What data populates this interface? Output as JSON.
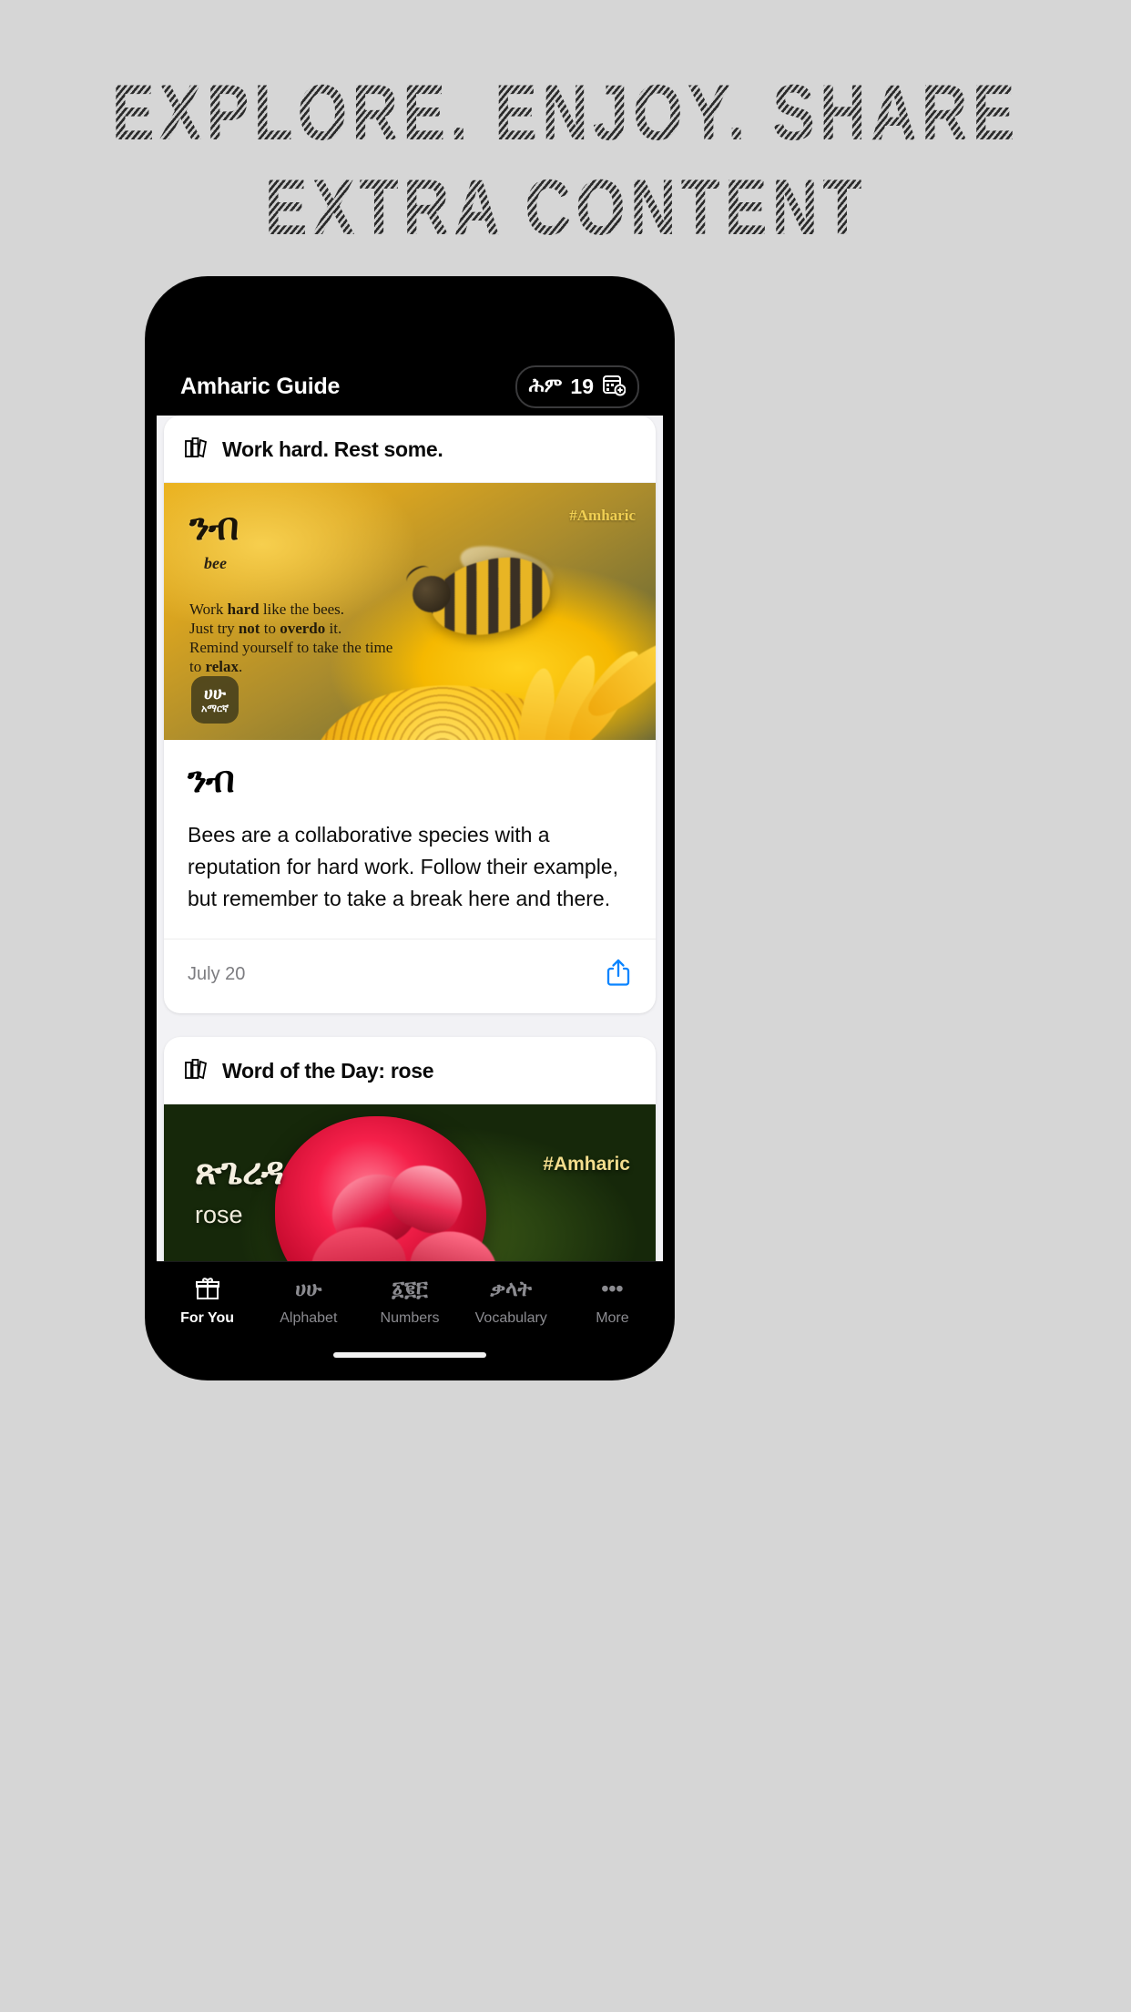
{
  "headline": {
    "line1": "EXPLORE. ENJOY. SHARE",
    "line2": "EXTRA CONTENT"
  },
  "colors": {
    "page_bg": "#d6d6d6",
    "headline": "#2b2b2b",
    "accent_blue": "#0a84ff",
    "card_bg": "#ffffff",
    "content_bg": "#f2f2f5",
    "chrome": "#000000"
  },
  "app": {
    "navbar": {
      "title": "Amharic Guide",
      "streak": {
        "amharic_label": "ሕም",
        "count": "19",
        "icon": "calendar-add-icon"
      }
    },
    "cards": [
      {
        "head": {
          "icon": "books-icon",
          "title": "Work hard. Rest some."
        },
        "hero": {
          "word": "ንብ",
          "translation": "bee",
          "body_line1_a": "Work ",
          "body_line1_b": "hard",
          "body_line1_c": " like the bees.",
          "body_line2_a": "Just try ",
          "body_line2_b": "not",
          "body_line2_c": " to ",
          "body_line2_d": "overdo",
          "body_line2_e": " it.",
          "body_line3": "Remind yourself to take the time",
          "body_line4_a": "to ",
          "body_line4_b": "relax",
          "body_line4_c": ".",
          "hashtag": "#Amharic",
          "watermark_top": "ሀሁ",
          "watermark_bottom": "አማርኛ"
        },
        "body": {
          "word": "ንብ",
          "description": "Bees are a collaborative species with a reputation for hard work. Follow their example, but remember to take a break here and there."
        },
        "footer": {
          "date": "July 20",
          "share_icon": "share-icon"
        }
      },
      {
        "head": {
          "icon": "books-icon",
          "title": "Word of the Day: rose"
        },
        "hero": {
          "word": "ጽጌረዳ",
          "translation": "rose",
          "hashtag": "#Amharic"
        }
      }
    ],
    "tabs": [
      {
        "label": "For You",
        "glyph": "❧",
        "icon": "gift-icon",
        "active": true
      },
      {
        "label": "Alphabet",
        "glyph": "ሀሁ",
        "icon": "alphabet-icon",
        "active": false
      },
      {
        "label": "Numbers",
        "glyph": "፩፪፫",
        "icon": "numbers-icon",
        "active": false
      },
      {
        "label": "Vocabulary",
        "glyph": "ቃላት",
        "icon": "vocabulary-icon",
        "active": false
      },
      {
        "label": "More",
        "glyph": "•••",
        "icon": "more-icon",
        "active": false
      }
    ]
  }
}
